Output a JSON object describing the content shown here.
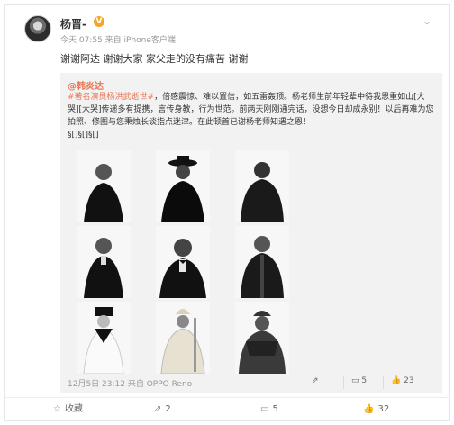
{
  "post": {
    "username": "杨晋-",
    "verified": "V",
    "meta": "今天 07:55 来自 iPhone客户端",
    "text": "谢谢阿达 谢谢大家 家父走的没有痛苦 谢谢"
  },
  "repost": {
    "author": "@韩炎达",
    "tag": "#著名演员杨洪武逝世#",
    "body_1": "，倍感震惊、难以置信，如五雷轰顶。杨老师生前年轻辈中待我恩重如山",
    "body_2": "[大哭][大哭]传递多有提携，言传身教，行为世范。前两天刚刚通完话，没想今日却成永别！以后再难为您拍照、修图与您秉烛长谈指点迷津。在此顿首已谢杨老师知遇之恩！",
    "body_3": "§[]§[]§[]",
    "footer_time": "12月5日 23:12 来自 OPPO Reno",
    "repost_count": "",
    "comment_count": "5",
    "like_count": "23"
  },
  "actions": {
    "favorite": "收藏",
    "repost": "2",
    "comment": "5",
    "like": "32"
  },
  "colors": {
    "accent": "#eb7350",
    "repost_bg": "#f2f2f2",
    "verified_badge": "#f5a623"
  },
  "icons": {
    "chevron": "chevron-down-icon",
    "favorite": "star-icon",
    "repost": "repost-icon",
    "comment": "comment-icon",
    "like": "thumbs-up-icon"
  }
}
